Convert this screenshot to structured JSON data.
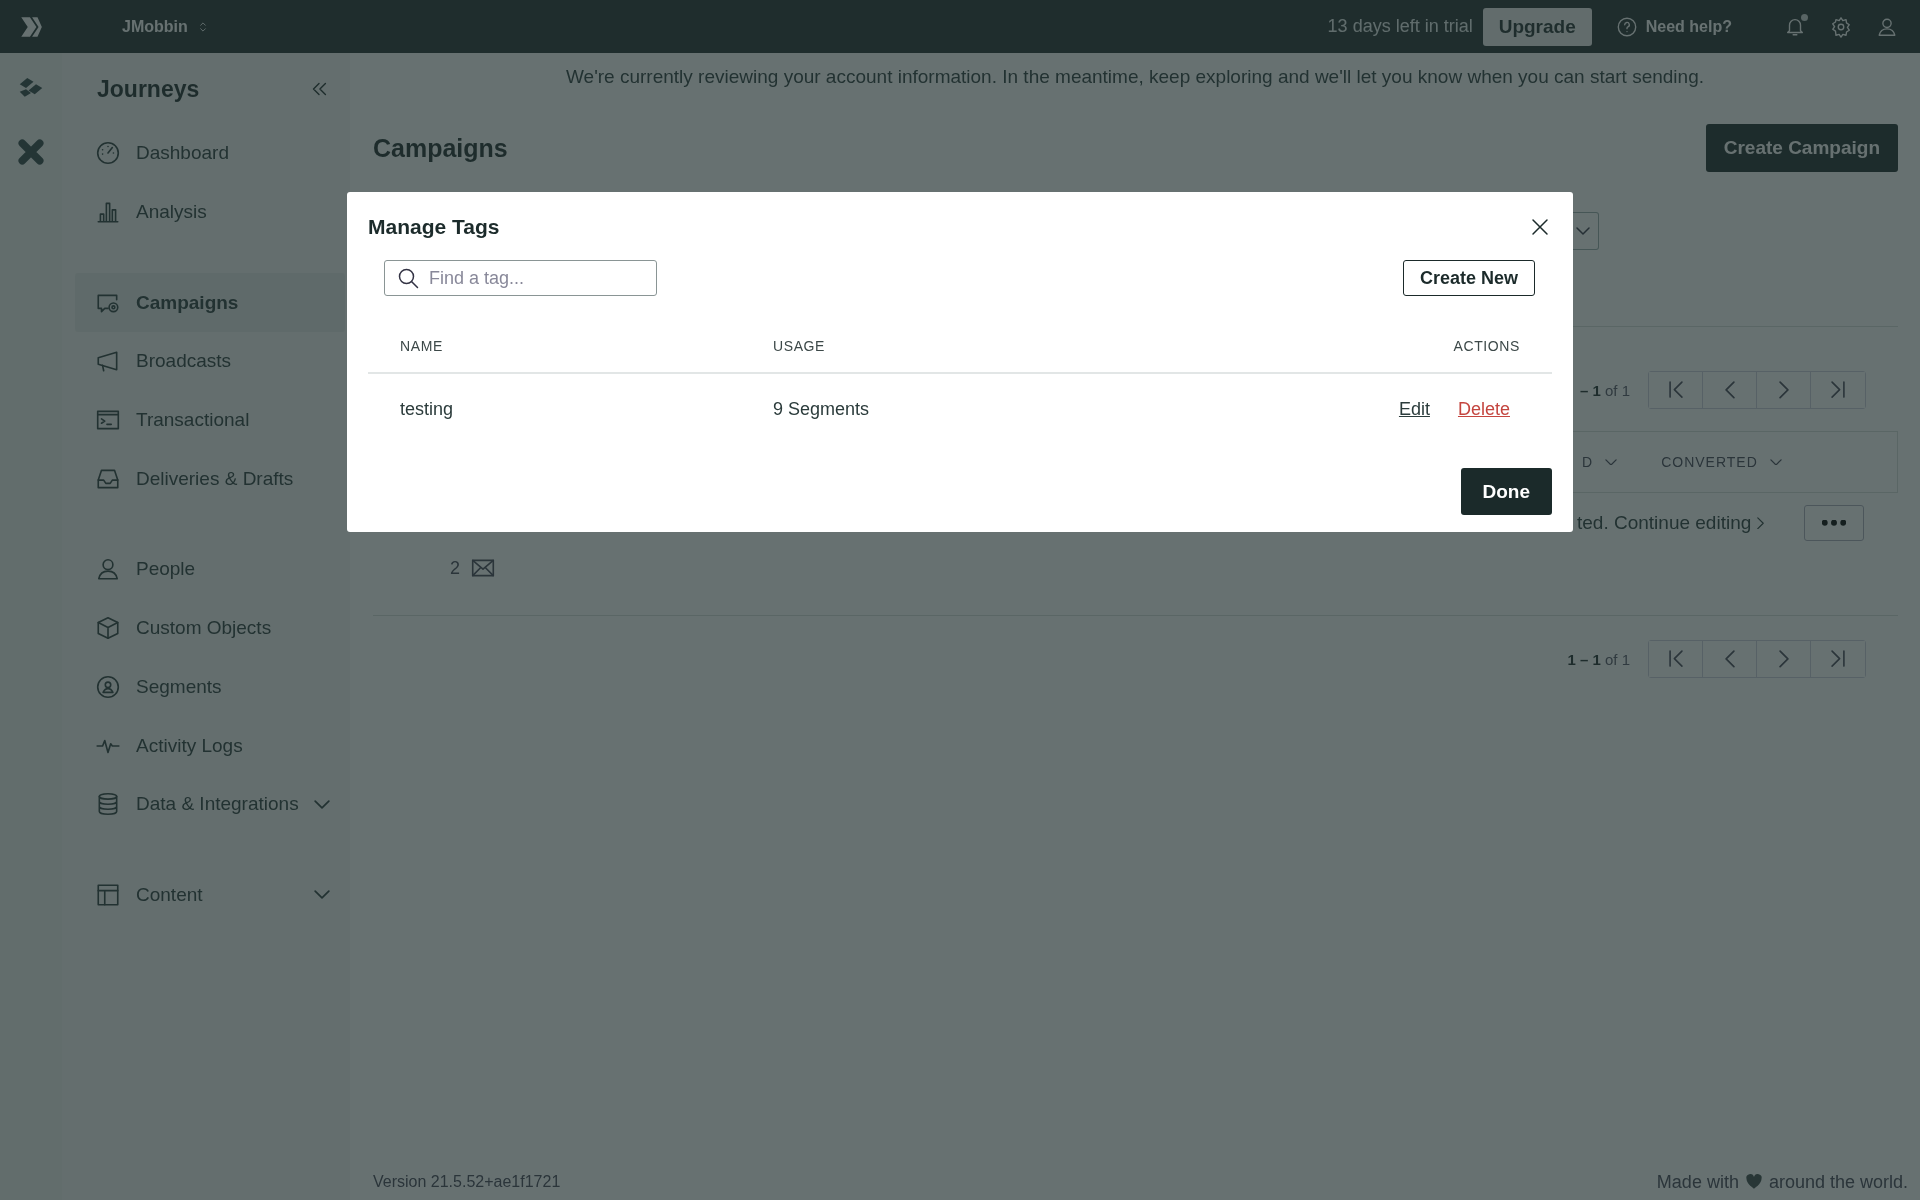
{
  "topbar": {
    "workspace": "JMobbin",
    "trial": "13 days left in trial",
    "upgrade": "Upgrade",
    "help": "Need help?",
    "notification": true
  },
  "banner": "We're currently reviewing your account information. In the meantime, keep exploring and we'll let you know when you can start sending.",
  "sidebar": {
    "title": "Journeys",
    "groups": [
      {
        "items": [
          {
            "label": "Dashboard",
            "kind": "link",
            "selected": false
          },
          {
            "label": "Analysis",
            "kind": "link",
            "selected": false
          }
        ]
      },
      {
        "items": [
          {
            "label": "Campaigns",
            "kind": "link",
            "selected": true
          },
          {
            "label": "Broadcasts",
            "kind": "link",
            "selected": false
          },
          {
            "label": "Transactional",
            "kind": "link",
            "selected": false
          },
          {
            "label": "Deliveries & Drafts",
            "kind": "link",
            "selected": false
          }
        ]
      },
      {
        "items": [
          {
            "label": "People",
            "kind": "link",
            "selected": false
          },
          {
            "label": "Custom Objects",
            "kind": "link",
            "selected": false
          },
          {
            "label": "Segments",
            "kind": "link",
            "selected": false
          },
          {
            "label": "Activity Logs",
            "kind": "link",
            "selected": false
          },
          {
            "label": "Data & Integrations",
            "kind": "group",
            "expanded": false,
            "selected": false
          }
        ]
      },
      {
        "items": [
          {
            "label": "Content",
            "kind": "group",
            "expanded": false,
            "selected": false
          }
        ]
      }
    ]
  },
  "page": {
    "title": "Campaigns",
    "create_button": "Create Campaign",
    "pagination_top": "**– 1** of 1",
    "columns": [
      "D",
      "CONVERTED"
    ],
    "row": {
      "status": "ted. Continue editing",
      "count": "2"
    },
    "pagination_bottom": "**1 – 1** of 1"
  },
  "footer": {
    "version": "Version 21.5.52+ae1f1721",
    "credit_before": "Made with",
    "credit_after": "around the world."
  },
  "modal": {
    "title": "Manage Tags",
    "search": {
      "placeholder": "Find a tag..."
    },
    "create_button": "Create New",
    "columns": [
      "NAME",
      "USAGE",
      "ACTIONS"
    ],
    "rows": [
      {
        "name": "testing",
        "usage": "9 Segments",
        "actions": [
          {
            "label": "Edit",
            "kind": "edit"
          },
          {
            "label": "Delete",
            "kind": "danger"
          }
        ]
      }
    ],
    "done_button": "Done"
  }
}
